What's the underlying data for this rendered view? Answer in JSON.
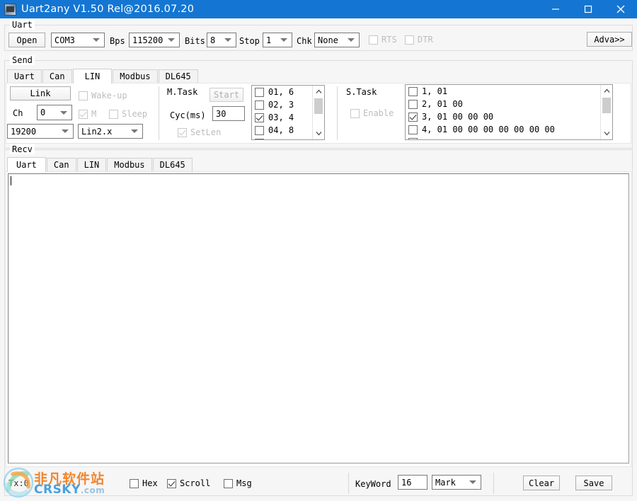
{
  "window": {
    "title": "Uart2any V1.50 Rel@2016.07.20",
    "icon": "app-icon",
    "minimize_label": "–",
    "maximize_label": "□",
    "close_label": "✕",
    "titlebar_color": "#1476d2"
  },
  "uart": {
    "group_title": "Uart",
    "open_button": "Open",
    "port": {
      "value": "COM3"
    },
    "bps": {
      "label": "Bps",
      "value": "115200"
    },
    "bits": {
      "label": "Bits",
      "value": "8"
    },
    "stop": {
      "label": "Stop",
      "value": "1"
    },
    "chk": {
      "label": "Chk",
      "value": "None"
    },
    "rts": {
      "label": "RTS",
      "checked": false,
      "enabled": false
    },
    "dtr": {
      "label": "DTR",
      "checked": false,
      "enabled": false
    },
    "adva_button": "Adva>>"
  },
  "send": {
    "group_title": "Send",
    "tabs": [
      {
        "label": "Uart",
        "active": false
      },
      {
        "label": "Can",
        "active": false
      },
      {
        "label": "LIN",
        "active": true
      },
      {
        "label": "Modbus",
        "active": false
      },
      {
        "label": "DL645",
        "active": false
      }
    ],
    "lin": {
      "link_button": "Link",
      "ch_label": "Ch",
      "ch_value": "0",
      "baud_value": "19200",
      "version_value": "Lin2.x",
      "wakeup": {
        "label": "Wake-up",
        "checked": false,
        "enabled": false
      },
      "m_flag": {
        "label": "M",
        "checked": true,
        "enabled": false
      },
      "sleep": {
        "label": "Sleep",
        "checked": false,
        "enabled": false
      }
    },
    "mtask": {
      "label": "M.Task",
      "start_button": "Start",
      "cyc_label": "Cyc(ms)",
      "cyc_value": "30",
      "setlen": {
        "label": "SetLen",
        "checked": true,
        "enabled": false
      },
      "items": [
        {
          "label": "01, 6",
          "checked": false
        },
        {
          "label": "02, 3",
          "checked": false
        },
        {
          "label": "03, 4",
          "checked": true
        },
        {
          "label": "04, 8",
          "checked": false
        }
      ]
    },
    "stask": {
      "label": "S.Task",
      "enable": {
        "label": "Enable",
        "checked": false,
        "enabled": false
      },
      "items": [
        {
          "label": "1, 01",
          "checked": false
        },
        {
          "label": "2, 01 00",
          "checked": false
        },
        {
          "label": "3, 01 00 00 00",
          "checked": true
        },
        {
          "label": "4, 01 00 00 00 00 00 00 00",
          "checked": false
        }
      ]
    }
  },
  "recv": {
    "group_title": "Recv",
    "tabs": [
      {
        "label": "Uart",
        "active": true
      },
      {
        "label": "Can",
        "active": false
      },
      {
        "label": "LIN",
        "active": false
      },
      {
        "label": "Modbus",
        "active": false
      },
      {
        "label": "DL645",
        "active": false
      }
    ],
    "content": ""
  },
  "bottom": {
    "status": "Tx:0",
    "hex": {
      "label": "Hex",
      "checked": false
    },
    "scroll": {
      "label": "Scroll",
      "checked": true
    },
    "msg": {
      "label": "Msg",
      "checked": false
    },
    "keyword_label": "KeyWord",
    "keyword_value": "16",
    "mark_value": "Mark",
    "clear_button": "Clear",
    "save_button": "Save"
  },
  "watermark": {
    "chinese": "非凡软件站",
    "english": "CRSKY",
    "suffix": ".com"
  }
}
